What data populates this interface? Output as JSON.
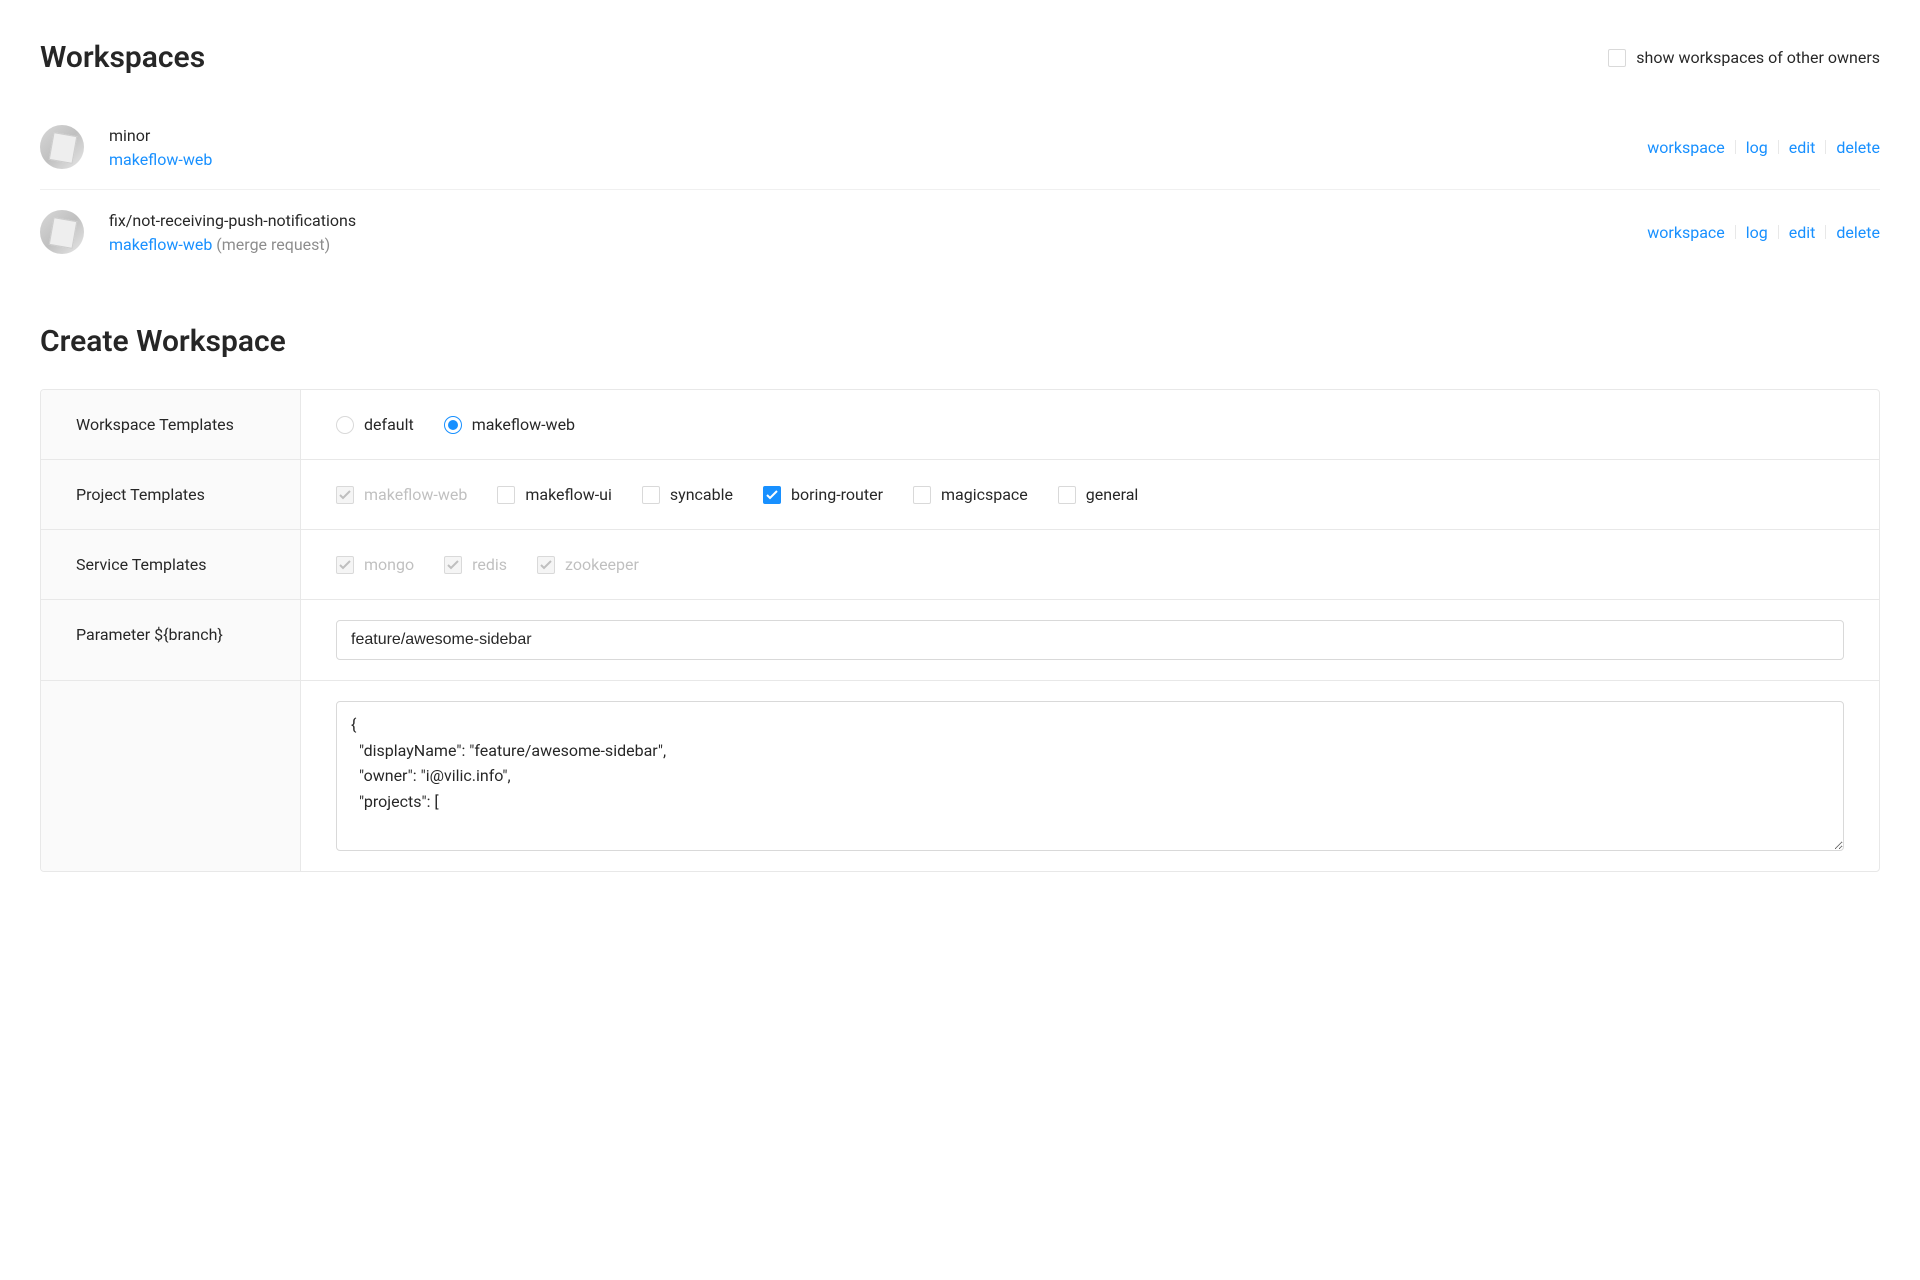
{
  "header": {
    "title": "Workspaces",
    "show_other_owners_label": "show workspaces of other owners",
    "show_other_owners_checked": false
  },
  "workspaces": [
    {
      "title": "minor",
      "repo": "makeflow-web",
      "suffix": "",
      "actions": {
        "workspace": "workspace",
        "log": "log",
        "edit": "edit",
        "delete": "delete"
      }
    },
    {
      "title": "fix/not-receiving-push-notifications",
      "repo": "makeflow-web",
      "suffix": " (merge request)",
      "actions": {
        "workspace": "workspace",
        "log": "log",
        "edit": "edit",
        "delete": "delete"
      }
    }
  ],
  "create": {
    "title": "Create Workspace",
    "labels": {
      "workspace_templates": "Workspace Templates",
      "project_templates": "Project Templates",
      "service_templates": "Service Templates",
      "parameter_branch": "Parameter ${branch}"
    },
    "workspace_templates": [
      {
        "label": "default",
        "selected": false
      },
      {
        "label": "makeflow-web",
        "selected": true
      }
    ],
    "project_templates": [
      {
        "label": "makeflow-web",
        "checked": true,
        "disabled": true
      },
      {
        "label": "makeflow-ui",
        "checked": false,
        "disabled": false
      },
      {
        "label": "syncable",
        "checked": false,
        "disabled": false
      },
      {
        "label": "boring-router",
        "checked": true,
        "disabled": false
      },
      {
        "label": "magicspace",
        "checked": false,
        "disabled": false
      },
      {
        "label": "general",
        "checked": false,
        "disabled": false
      }
    ],
    "service_templates": [
      {
        "label": "mongo",
        "checked": true,
        "disabled": true
      },
      {
        "label": "redis",
        "checked": true,
        "disabled": true
      },
      {
        "label": "zookeeper",
        "checked": true,
        "disabled": true
      }
    ],
    "parameter_value": "feature/awesome-sidebar",
    "json_preview": "{\n  \"displayName\": \"feature/awesome-sidebar\",\n  \"owner\": \"i@vilic.info\",\n  \"projects\": ["
  }
}
